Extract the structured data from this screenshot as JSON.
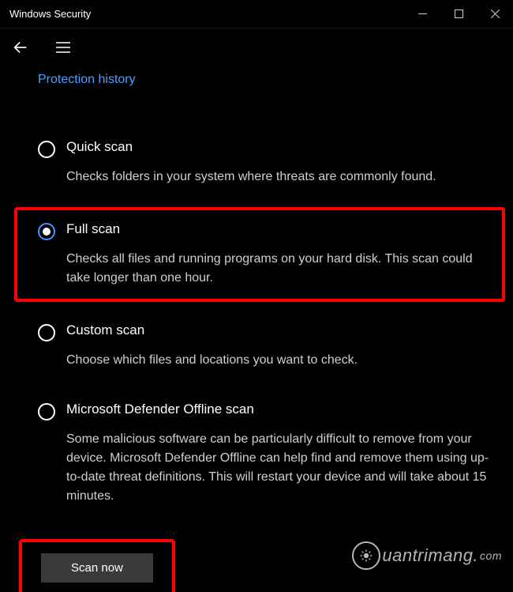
{
  "window": {
    "title": "Windows Security"
  },
  "nav": {
    "protection_history": "Protection history"
  },
  "scan_options": [
    {
      "id": "quick-scan",
      "title": "Quick scan",
      "desc": "Checks folders in your system where threats are commonly found.",
      "selected": false,
      "highlighted": false
    },
    {
      "id": "full-scan",
      "title": "Full scan",
      "desc": "Checks all files and running programs on your hard disk. This scan could take longer than one hour.",
      "selected": true,
      "highlighted": true
    },
    {
      "id": "custom-scan",
      "title": "Custom scan",
      "desc": "Choose which files and locations you want to check.",
      "selected": false,
      "highlighted": false
    },
    {
      "id": "offline-scan",
      "title": "Microsoft Defender Offline scan",
      "desc": "Some malicious software can be particularly difficult to remove from your device. Microsoft Defender Offline can help find and remove them using up-to-date threat definitions. This will restart your device and will take about 15 minutes.",
      "selected": false,
      "highlighted": false
    }
  ],
  "action": {
    "scan_now": "Scan now",
    "highlighted": true
  },
  "watermark": {
    "text": "uantrimang.",
    "suffix": "com"
  }
}
